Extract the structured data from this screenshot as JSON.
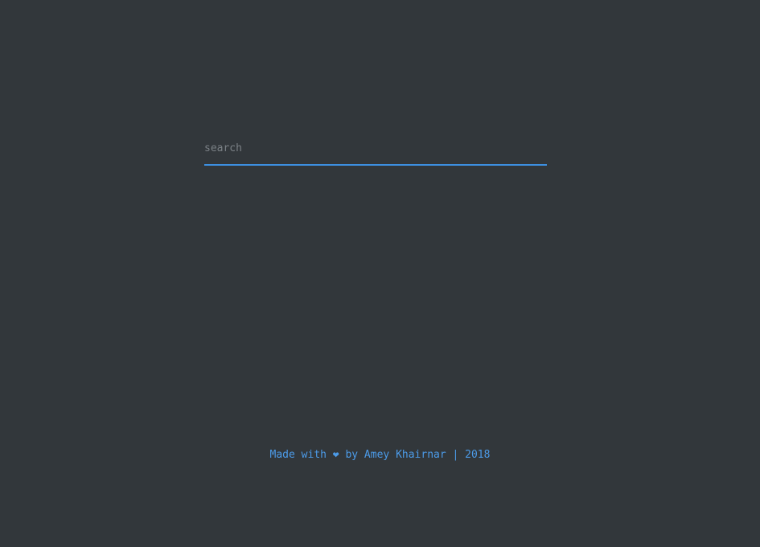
{
  "search": {
    "placeholder": "search",
    "value": ""
  },
  "footer": {
    "text": "Made with ❤ by Amey Khairnar | 2018"
  },
  "colors": {
    "background": "#32373b",
    "accent": "#3d8fe0",
    "footer_text": "#4c9be8",
    "placeholder_text": "#7b8186"
  }
}
